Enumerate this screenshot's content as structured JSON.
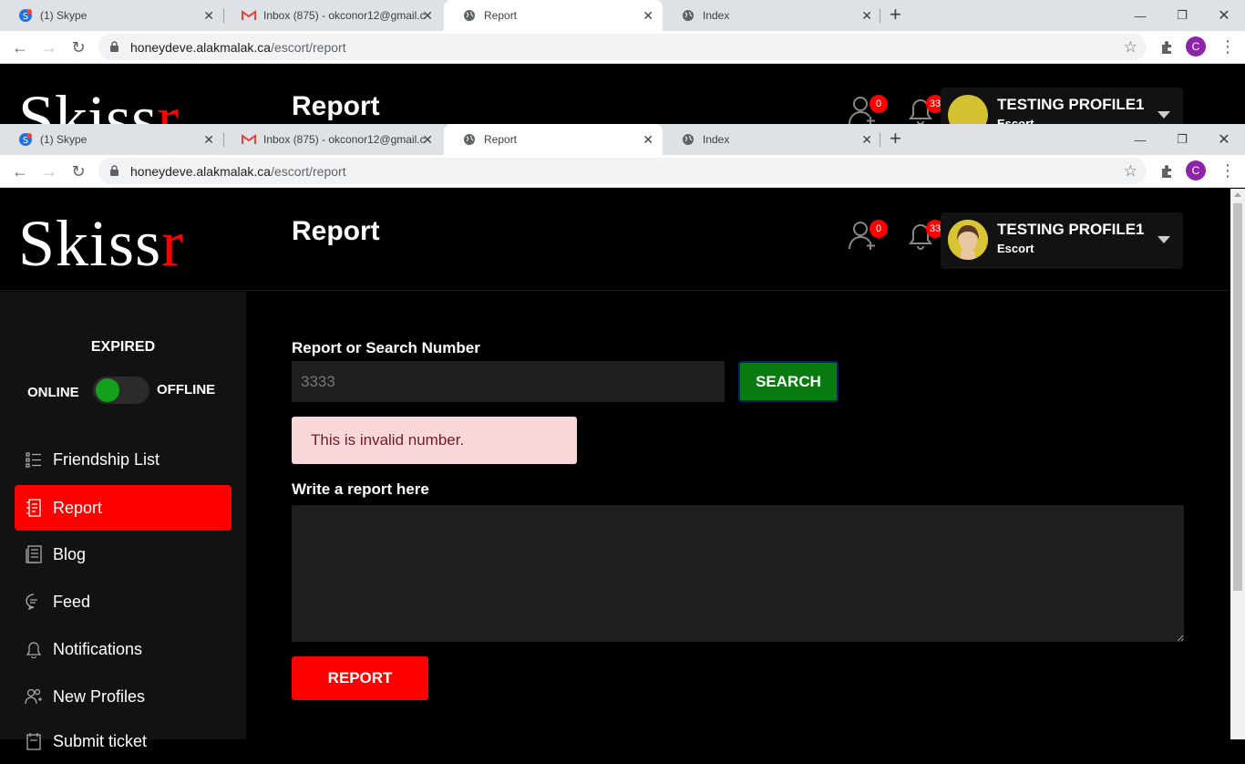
{
  "browser": {
    "tabs": [
      {
        "title": "(1) Skype",
        "icon": "skype-icon"
      },
      {
        "title": "Inbox (875) - okconor12@gmail.c",
        "icon": "gmail-icon"
      },
      {
        "title": "Report",
        "icon": "globe-icon"
      },
      {
        "title": "Index",
        "icon": "globe-icon"
      }
    ],
    "url_host": "honeydeve.alakmalak.ca",
    "url_path": "/escort/report",
    "profile_initial": "C"
  },
  "app": {
    "logo_main": "Skiss",
    "logo_accent": "r",
    "page_title": "Report",
    "friend_requests_count": "0",
    "notifications_count": "33",
    "user": {
      "name": "TESTING PROFILE1",
      "role": "Escort"
    },
    "sidebar": {
      "status": "EXPIRED",
      "online_label": "ONLINE",
      "offline_label": "OFFLINE",
      "items": [
        {
          "label": "Friendship List",
          "icon": "list-icon"
        },
        {
          "label": "Report",
          "icon": "report-icon"
        },
        {
          "label": "Blog",
          "icon": "blog-icon"
        },
        {
          "label": "Feed",
          "icon": "chat-bubble-icon"
        },
        {
          "label": "Notifications",
          "icon": "bell-icon"
        },
        {
          "label": "New Profiles",
          "icon": "users-icon"
        },
        {
          "label": "Submit ticket",
          "icon": "ticket-icon"
        }
      ]
    },
    "form": {
      "search_label": "Report or Search Number",
      "search_value": "3333",
      "search_button": "SEARCH",
      "error": "This is invalid number.",
      "report_label": "Write a report here",
      "report_button": "REPORT"
    }
  },
  "colors": {
    "accent": "#ff0000",
    "success": "#087a0f",
    "alert_bg": "#f8d7da",
    "alert_text": "#721c24"
  }
}
